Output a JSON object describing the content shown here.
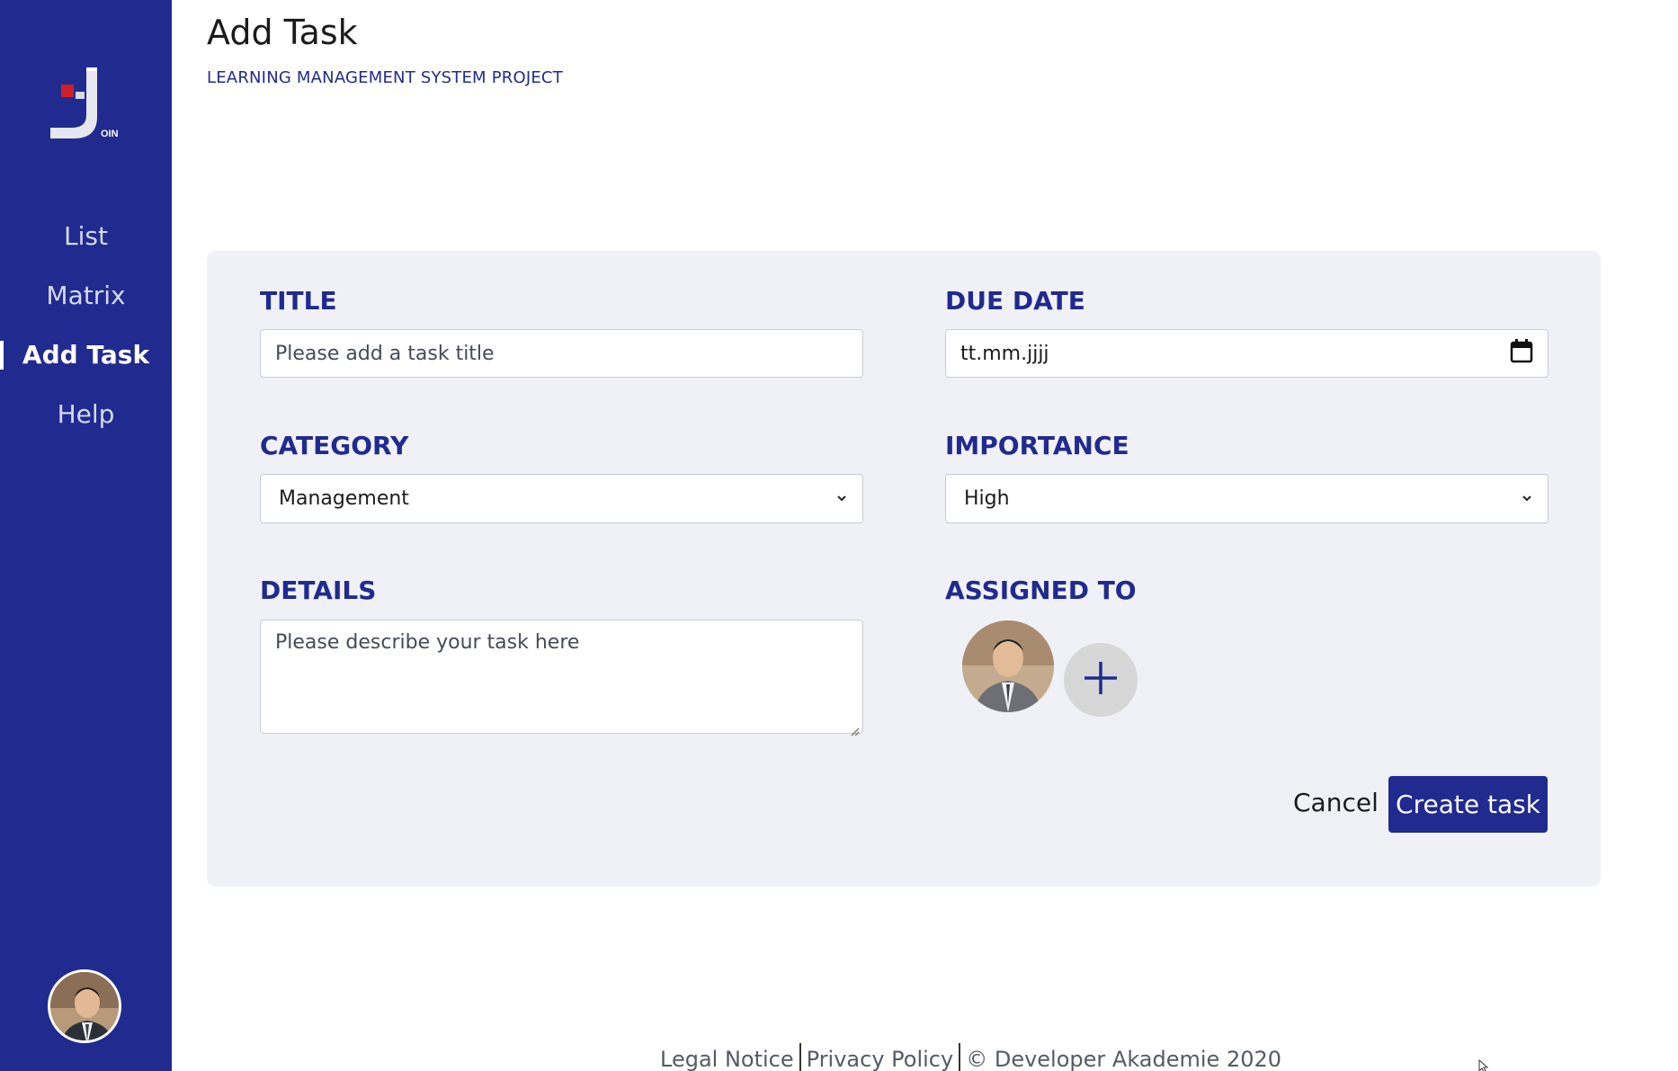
{
  "sidebar": {
    "logo_text": "OIN",
    "items": [
      {
        "label": "List",
        "active": false
      },
      {
        "label": "Matrix",
        "active": false
      },
      {
        "label": "Add Task",
        "active": true
      },
      {
        "label": "Help",
        "active": false
      }
    ],
    "accent": "#212a8f",
    "logo_accent": "#cc1f2a"
  },
  "header": {
    "title": "Add Task",
    "subtitle": "LEARNING MANAGEMENT SYSTEM PROJECT"
  },
  "form": {
    "title_label": "TITLE",
    "title_placeholder": "Please add a task title",
    "due_date_label": "DUE DATE",
    "due_date_value": "tt.mm.jjjj",
    "category_label": "CATEGORY",
    "category_value": "Management",
    "importance_label": "IMPORTANCE",
    "importance_value": "High",
    "details_label": "DETAILS",
    "details_placeholder": "Please describe your task here",
    "assigned_label": "ASSIGNED TO"
  },
  "actions": {
    "cancel_label": "Cancel",
    "create_label": "Create task"
  },
  "footer": {
    "legal": "Legal Notice",
    "privacy": "Privacy Policy",
    "copyright": "© Developer Akademie 2020"
  }
}
